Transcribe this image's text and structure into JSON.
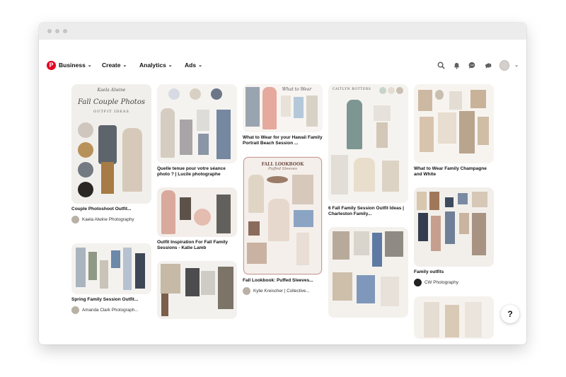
{
  "nav": {
    "items": [
      {
        "label": "Business"
      },
      {
        "label": "Create"
      },
      {
        "label": "Analytics"
      },
      {
        "label": "Ads"
      }
    ],
    "logo_letter": "P",
    "help": "?"
  },
  "pins": {
    "p1": {
      "overlay_title": "Kaela Alwine",
      "overlay_sub": "Fall Couple Photos",
      "overlay_sub2": "OUTFIT IDEAS",
      "caption": "Couple Photoshoot Outfit...",
      "author": "Kaela Alwine Photography"
    },
    "p2": {
      "caption": "Spring Family Session Outfit...",
      "author": "Amanda Clark Photograph..."
    },
    "p3": {
      "caption": "Quelle tenue pour votre séance photo ? | Lucile photographe"
    },
    "p4": {
      "caption": "Outfit Inspiration For Fall Family Sessions - Katie Lamb"
    },
    "p5": {
      "overlay_title": "What to Wear",
      "caption": "What to Wear for your Hawaii Family Portrait Beach Session ..."
    },
    "p6": {
      "overlay_title": "FALL LOOKBOOK",
      "overlay_sub": "Puffed Sleeves",
      "caption": "Fall Lookbook: Puffed Sleeves...",
      "author": "Kylie Kreischer | Collective..."
    },
    "p7": {
      "overlay_title": "CAITLYN ROTTERS",
      "caption": "6 Fall Family Session Outfit Ideas | Charleston Family..."
    },
    "p8": {
      "caption": ""
    },
    "p9": {
      "caption": "What to Wear Family Champagne and White"
    },
    "p10": {
      "caption": "Family outfits",
      "author": "CW Photography"
    },
    "p11": {
      "caption": ""
    }
  },
  "colors": {
    "brand": "#e60023"
  }
}
